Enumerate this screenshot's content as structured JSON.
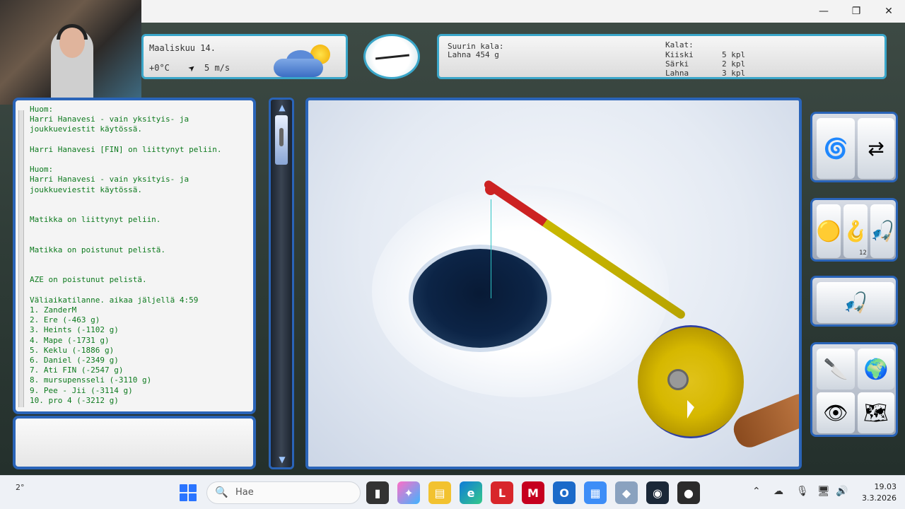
{
  "window": {
    "minimize": "—",
    "restore": "❐",
    "close": "✕"
  },
  "weather": {
    "date": "Maaliskuu 14.",
    "temperature": "+0°C",
    "wind": "5 m/s",
    "condition_icon": "partly-cloudy-icon"
  },
  "compass": {
    "icon": "compass-icon"
  },
  "records": {
    "biggest_label": "Suurin kala:",
    "biggest_value": "Lahna 454 g",
    "catch_label": "Kalat:",
    "catches": [
      {
        "name": "Kiiski",
        "count": "5 kpl"
      },
      {
        "name": "Särki",
        "count": "2 kpl"
      },
      {
        "name": "Lahna",
        "count": "3 kpl"
      }
    ]
  },
  "chat": {
    "lines": [
      "Huom:",
      "Harri Hanavesi - vain yksityis- ja",
      "joukkueviestit käytössä.",
      "",
      "Harri Hanavesi [FIN] on liittynyt peliin.",
      "",
      "Huom:",
      "Harri Hanavesi - vain yksityis- ja",
      "joukkueviestit käytössä.",
      "",
      "",
      "Matikka on liittynyt peliin.",
      "",
      "",
      "Matikka on poistunut pelistä.",
      "",
      "",
      "AZE on poistunut pelistä.",
      "",
      "Väliaikatilanne. aikaa jäljellä 4:59",
      "1. ZanderM",
      "2. Ere (-463 g)",
      "3. Heints (-1102 g)",
      "4. Mape (-1731 g)",
      "5. Keklu (-1886 g)",
      "6. Daniel (-2349 g)",
      "7. Ati FIN (-2547 g)",
      "8. mursupensseli (-3110 g)",
      "9. Pee - Jii (-3114 g)",
      "10. pro 4 (-3212 g)"
    ]
  },
  "depth": {
    "up": "▲",
    "down": "▼",
    "level": 0.15
  },
  "tools": {
    "drill": "ice-drill-icon",
    "switch": "switch-hole-icon",
    "lures": [
      "lure-yellow-icon",
      "lure-red-icon",
      "lure-spoon-icon"
    ],
    "lure_count": "12",
    "rod": "ice-rod-icon",
    "knife": "knife-icon",
    "globe": "globe-icon",
    "eye": "eye-icon",
    "map": "map-icon"
  },
  "taskbar": {
    "weather_temp": "2°",
    "search_placeholder": "Hae",
    "apps": [
      "file-explorer-icon",
      "copilot-icon",
      "folder-icon",
      "edge-icon",
      "l-app-icon",
      "mcafee-icon",
      "outlook-icon",
      "store-icon",
      "game-icon",
      "steam-icon",
      "obs-icon"
    ],
    "app_l_label": "L",
    "time": "19.03",
    "date": "3.3.2026"
  }
}
